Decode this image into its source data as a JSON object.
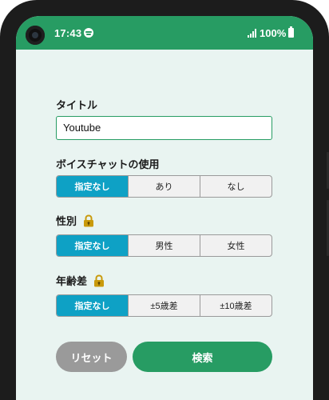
{
  "status_bar": {
    "time": "17:43",
    "battery": "100%",
    "icons": [
      "camera-hole",
      "spotify-icon",
      "signal-icon",
      "battery-icon"
    ],
    "color": "#279c63"
  },
  "form": {
    "title_label": "タイトル",
    "title_value": "Youtube",
    "voice_chat": {
      "label": "ボイスチャットの使用",
      "options": [
        "指定なし",
        "あり",
        "なし"
      ],
      "selected": 0
    },
    "gender": {
      "label": "性別",
      "locked_icon": "lock-icon",
      "options": [
        "指定なし",
        "男性",
        "女性"
      ],
      "selected": 0
    },
    "age_gap": {
      "label": "年齢差",
      "locked_icon": "lock-icon",
      "options": [
        "指定なし",
        "±5歳差",
        "±10歳差"
      ],
      "selected": 0
    }
  },
  "actions": {
    "reset_label": "リセット",
    "search_label": "検索"
  },
  "colors": {
    "accent_green": "#279c63",
    "segment_active": "#0ea1c5",
    "background": "#e9f4f1",
    "lock_gold": "#c99a0b"
  }
}
